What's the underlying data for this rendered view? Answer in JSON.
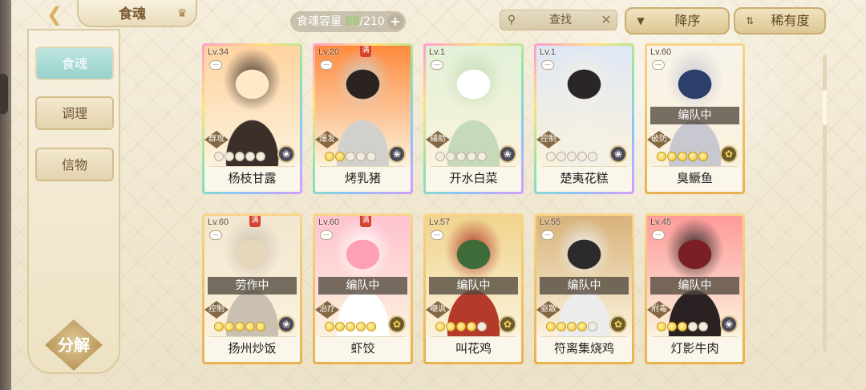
{
  "header": {
    "back_icon": "back-arrow-icon",
    "title": "食魂",
    "crown_icon": "crown-icon",
    "capacity_label": "食魂容量",
    "capacity_current": "88",
    "capacity_sep_max": "/210",
    "capacity_plus": "+",
    "search_label": "查找",
    "search_clear": "✕",
    "sort_order_label": "降序",
    "sort_rarity_label": "稀有度"
  },
  "sidebar": {
    "items": [
      {
        "label": "食魂",
        "active": true
      },
      {
        "label": "调理",
        "active": false
      },
      {
        "label": "信物",
        "active": false
      }
    ],
    "decompose_label": "分解"
  },
  "cards": [
    {
      "level": "Lv.34",
      "name": "杨枝甘露",
      "role": "群攻",
      "status": "",
      "full": false,
      "stars": 0,
      "rarity": "ur",
      "element": "flower",
      "art": [
        "#ffd3a0",
        "#ffe9c7",
        "#3c2f2a"
      ]
    },
    {
      "level": "Lv.20",
      "name": "烤乳猪",
      "role": "爆发",
      "status": "",
      "full": true,
      "stars": 2,
      "rarity": "ur",
      "element": "flower",
      "art": [
        "#ff8a3d",
        "#2b2320",
        "#d1d0cc"
      ]
    },
    {
      "level": "Lv.1",
      "name": "开水白菜",
      "role": "辅助",
      "status": "",
      "full": false,
      "stars": 0,
      "rarity": "ur",
      "element": "flower",
      "art": [
        "#e2f1d8",
        "#ffffff",
        "#c4dab8"
      ]
    },
    {
      "level": "Lv.1",
      "name": "楚夷花糕",
      "role": "控制",
      "status": "",
      "full": false,
      "stars": 0,
      "rarity": "ur",
      "element": "flower",
      "art": [
        "#dfe7f5",
        "#2a2628",
        "#f3f0e6"
      ]
    },
    {
      "level": "Lv.60",
      "name": "臭鳜鱼",
      "role": "破防",
      "status": "编队中",
      "full": false,
      "stars": 5,
      "rarity": "sp",
      "element": "gold",
      "art": [
        "#f8f3ea",
        "#2d3e6b",
        "#c8c8d0"
      ]
    },
    {
      "level": "Lv.60",
      "name": "扬州炒饭",
      "role": "控制",
      "status": "劳作中",
      "full": true,
      "stars": 5,
      "rarity": "sp",
      "element": "flower",
      "art": [
        "#f2e6cf",
        "#e6d6bb",
        "#c9c0b2"
      ]
    },
    {
      "level": "Lv.60",
      "name": "虾饺",
      "role": "治疗",
      "status": "编队中",
      "full": true,
      "stars": 5,
      "rarity": "sp",
      "element": "gold",
      "art": [
        "#ffc2cf",
        "#ff9fb5",
        "#ffffff"
      ]
    },
    {
      "level": "Lv.57",
      "name": "叫花鸡",
      "role": "嘲讽",
      "status": "编队中",
      "full": false,
      "stars": 4,
      "rarity": "sp",
      "element": "gold",
      "art": [
        "#f0d48c",
        "#3f6b3a",
        "#b43a2a"
      ]
    },
    {
      "level": "Lv.55",
      "name": "符离集烧鸡",
      "role": "驱散",
      "status": "编队中",
      "full": false,
      "stars": 4,
      "rarity": "sp",
      "element": "gold",
      "art": [
        "#d8b27a",
        "#2b2b2b",
        "#ececec"
      ]
    },
    {
      "level": "Lv.45",
      "name": "灯影牛肉",
      "role": "附毒",
      "status": "编队中",
      "full": false,
      "stars": 3,
      "rarity": "sp",
      "element": "flower",
      "art": [
        "#ff9a9a",
        "#7b1f24",
        "#2a2222"
      ]
    }
  ],
  "colors": {
    "active_tab": "#95d1ca",
    "accent_gold": "#d9b25a",
    "capacity_current": "#8bd05a"
  }
}
